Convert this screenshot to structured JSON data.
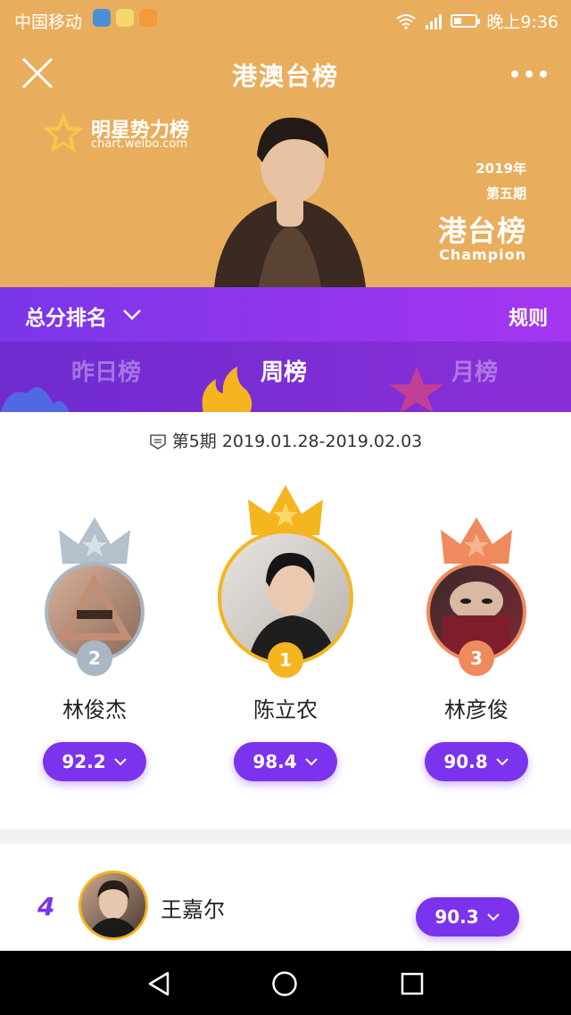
{
  "status_bar": {
    "carrier": "中国移动",
    "time": "晚上9:36"
  },
  "header": {
    "title": "港澳台榜"
  },
  "banner": {
    "logo_name": "明星势力榜",
    "logo_url": "chart.weibo.com",
    "year": "2019年",
    "issue": "第五期",
    "chart_name": "港台榜",
    "champion": "Champion"
  },
  "sort": {
    "label": "总分排名",
    "rules": "规则"
  },
  "tabs": [
    {
      "label": "昨日榜",
      "active": false
    },
    {
      "label": "周榜",
      "active": true
    },
    {
      "label": "月榜",
      "active": false
    }
  ],
  "period": "第5期 2019.01.28-2019.02.03",
  "podium": [
    {
      "rank": "2",
      "name": "林俊杰",
      "score": "92.2",
      "color": "#A9B6C4"
    },
    {
      "rank": "1",
      "name": "陈立农",
      "score": "98.4",
      "color": "#F4B51E"
    },
    {
      "rank": "3",
      "name": "林彦俊",
      "score": "90.8",
      "color": "#EF8A5E"
    }
  ],
  "list": [
    {
      "rank": "4",
      "name": "王嘉尔",
      "score": "90.3"
    }
  ],
  "colors": {
    "banner": "#E8AE5E",
    "accent": "#7B33EE",
    "gold": "#F4B51E",
    "silver": "#A9B6C4",
    "bronze": "#EF8A5E"
  }
}
